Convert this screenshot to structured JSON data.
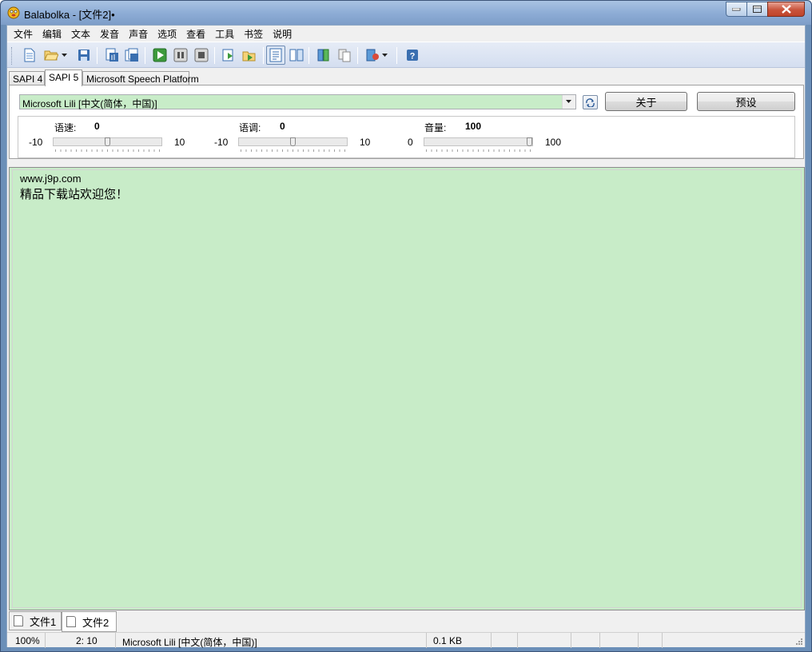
{
  "window": {
    "title": "Balabolka - [文件2]•"
  },
  "menu": [
    "文件",
    "编辑",
    "文本",
    "发音",
    "声音",
    "选项",
    "查看",
    "工具",
    "书签",
    "说明"
  ],
  "toolbar": {
    "buttons": [
      {
        "name": "new-document-icon"
      },
      {
        "name": "open-folder-icon"
      },
      {
        "name": "open-dropdown-arrow-icon"
      },
      {
        "name": "save-icon"
      },
      {
        "name": "save-audio-icon"
      },
      {
        "name": "batch-convert-icon"
      },
      {
        "name": "play-icon"
      },
      {
        "name": "pause-icon"
      },
      {
        "name": "stop-icon"
      },
      {
        "name": "read-clipboard-icon"
      },
      {
        "name": "read-file-icon"
      },
      {
        "name": "text-view-icon"
      },
      {
        "name": "split-view-icon"
      },
      {
        "name": "dictionary-icon"
      },
      {
        "name": "copy-pages-icon"
      },
      {
        "name": "voice-settings-icon"
      },
      {
        "name": "voice-dropdown-arrow-icon"
      },
      {
        "name": "help-icon"
      }
    ]
  },
  "sapi_tabs": [
    "SAPI 4",
    "SAPI 5",
    "Microsoft Speech Platform"
  ],
  "voice": {
    "selected": "Microsoft Lili [中文(简体，中国)]",
    "about_label": "关于",
    "preset_label": "预设"
  },
  "sliders": {
    "rate": {
      "label": "语速:",
      "value": "0",
      "min": "-10",
      "max": "10",
      "fraction": 0.5
    },
    "pitch": {
      "label": "语调:",
      "value": "0",
      "min": "-10",
      "max": "10",
      "fraction": 0.5
    },
    "volume": {
      "label": "音量:",
      "value": "100",
      "min": "0",
      "max": "100",
      "fraction": 1.0
    }
  },
  "editor": {
    "line1": "www.j9p.com",
    "line2": "精品下载站欢迎您！"
  },
  "doc_tabs": [
    "文件1",
    "文件2"
  ],
  "status": {
    "zoom": "100%",
    "position": "2:  10",
    "voice": "Microsoft Lili [中文(简体，中国)]",
    "size": "0.1 KB"
  },
  "colors": {
    "editor_bg": "#c8ecc8",
    "voice_select_bg": "#c8ecc8",
    "titlebar": "#8eadd6"
  }
}
